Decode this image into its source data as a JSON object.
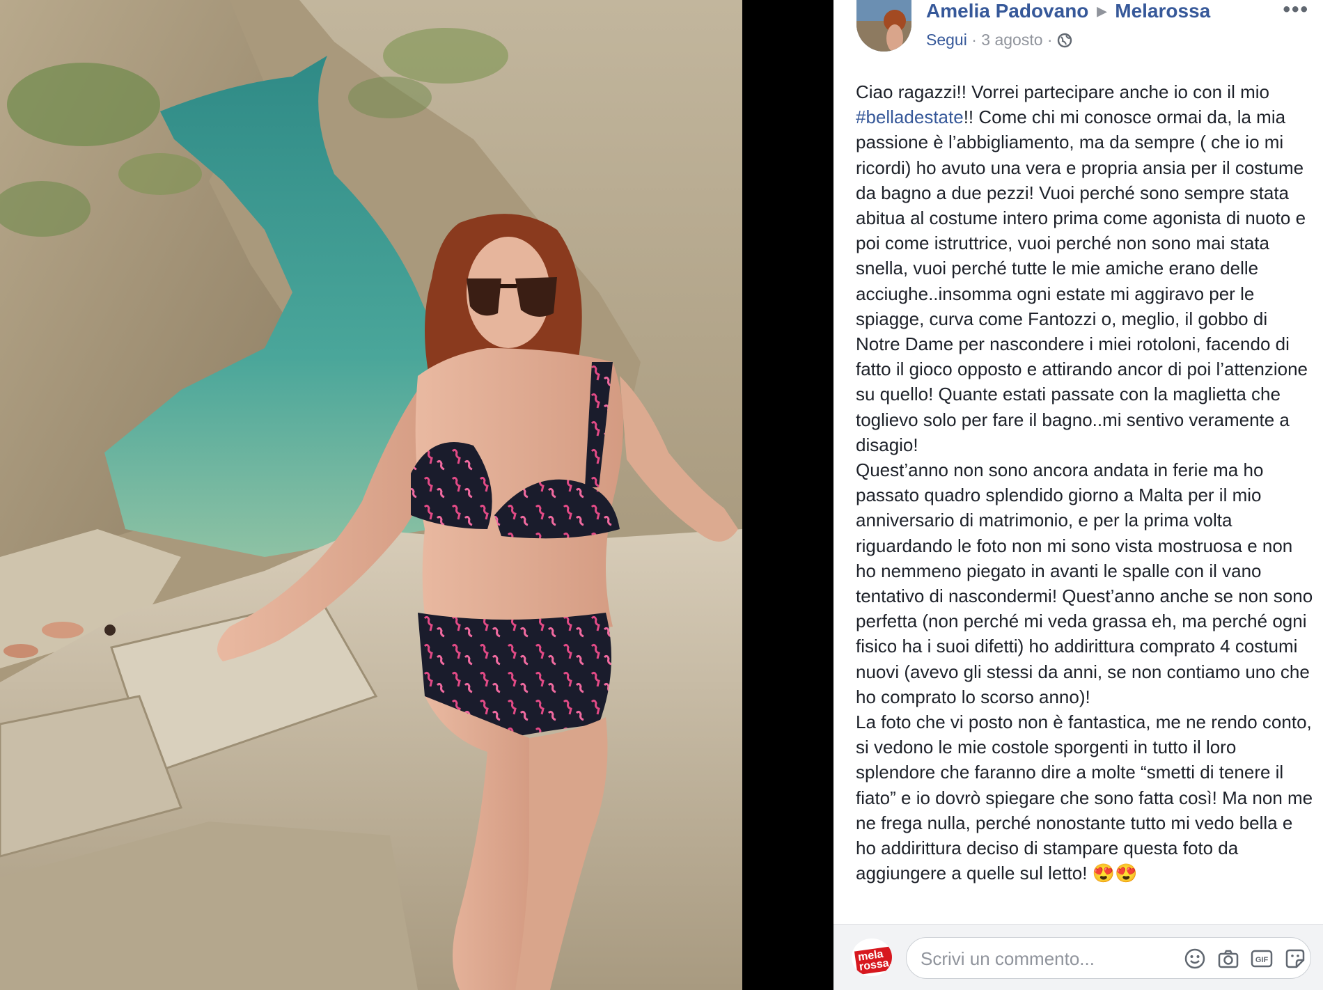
{
  "post": {
    "author": "Amelia Padovano",
    "group": "Melarossa",
    "follow": "Segui",
    "date": "3 agosto",
    "separator": "·",
    "more": "•••",
    "paragraph1_a": "Ciao ragazzi!! Vorrei partecipare anche io con il mio ",
    "hashtag": "#belladestate",
    "paragraph1_b": "!! Come chi mi conosce ormai da, la mia passione è l’abbigliamento, ma da sempre ( che io mi ricordi) ho avuto una vera e propria ansia per il costume da bagno a due pezzi! Vuoi perché sono sempre stata abitua al costume intero prima come agonista di nuoto e poi come istruttrice, vuoi perché non sono mai stata snella, vuoi perché tutte le mie amiche erano delle acciughe..insomma ogni estate mi aggiravo per le spiagge, curva come Fantozzi o, meglio, il gobbo di Notre Dame per nascondere i miei rotoloni, facendo di fatto il gioco opposto e attirando ancor di poi l’attenzione su quello! Quante estati passate con la maglietta che toglievo solo per fare il bagno..mi sentivo veramente a disagio!",
    "paragraph2": "Quest’anno non sono ancora andata in ferie ma ho passato quadro splendido giorno a Malta per il mio anniversario di matrimonio, e per la prima volta riguardando le foto non mi sono vista mostruosa e non ho nemmeno piegato in avanti le spalle con il vano tentativo di nascondermi! Quest’anno anche se non sono perfetta (non perché mi veda grassa eh, ma perché ogni fisico ha i suoi difetti) ho addirittura comprato 4 costumi nuovi (avevo gli stessi da anni, se non contiamo uno che ho comprato lo scorso anno)!",
    "paragraph3": "La foto che vi posto non è fantastica, me ne rendo conto, si vedono le mie costole sporgenti in tutto il loro splendore che faranno dire a molte “smetti di tenere il fiato” e io dovrò spiegare che sono fatta così! Ma non me ne frega nulla, perché nonostante tutto mi vedo bella e ho addirittura deciso di stampare questa foto da aggiungere a quelle sul letto! ",
    "emoji": "😍😍"
  },
  "comment": {
    "placeholder": "Scrivi un commento...",
    "page_logo": "mela rossa.it",
    "icons": [
      "smiley-icon",
      "camera-icon",
      "gif-icon",
      "sticker-icon"
    ],
    "gif_label": "GIF"
  },
  "colors": {
    "link": "#365899",
    "meta": "#90949c",
    "text": "#1d2129",
    "brand_red": "#d7181f"
  }
}
